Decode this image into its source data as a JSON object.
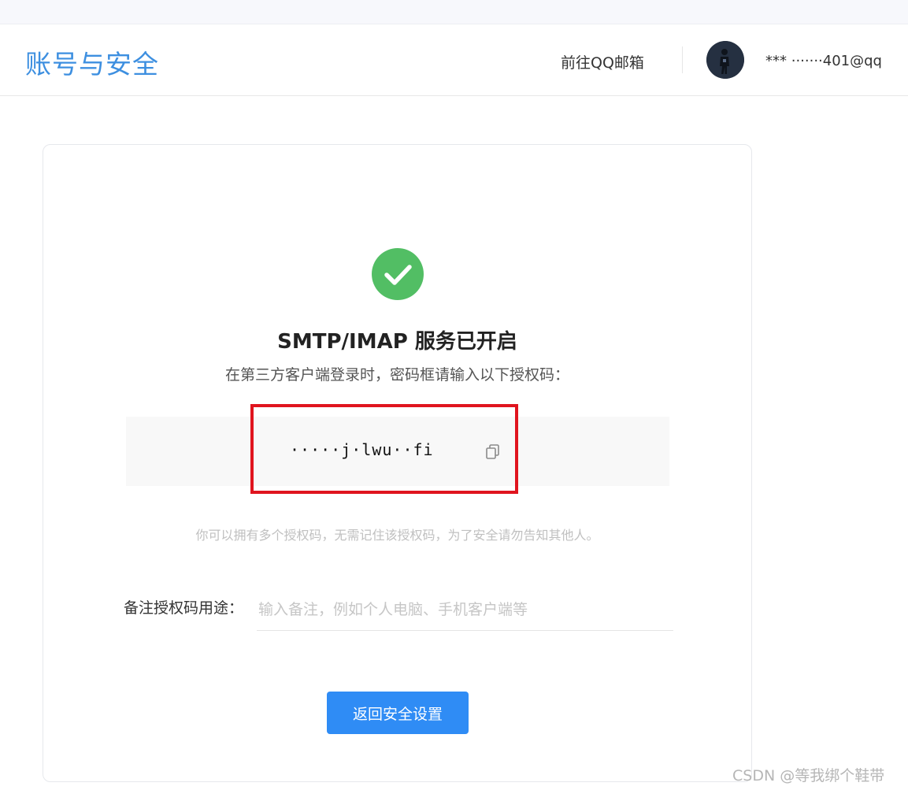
{
  "header": {
    "title": "账号与安全",
    "goto_mail": "前往QQ邮箱",
    "account": "*** ·······401@qq"
  },
  "card": {
    "title": "SMTP/IMAP 服务已开启",
    "subtitle": "在第三方客户端登录时，密码框请输入以下授权码：",
    "auth_code": "·····j·lwu··fi",
    "note": "你可以拥有多个授权码，无需记住该授权码，为了安全请勿告知其他人。",
    "memo_label": "备注授权码用途：",
    "memo_placeholder": "输入备注，例如个人电脑、手机客户端等",
    "memo_value": "",
    "back_button": "返回安全设置"
  },
  "icons": {
    "success": "check-circle-icon",
    "copy": "copy-icon"
  },
  "colors": {
    "brand": "#3d8fe0",
    "success": "#52be64",
    "primary_button": "#2f8cf5",
    "highlight": "#e0141e"
  },
  "watermark": "CSDN @等我绑个鞋带"
}
